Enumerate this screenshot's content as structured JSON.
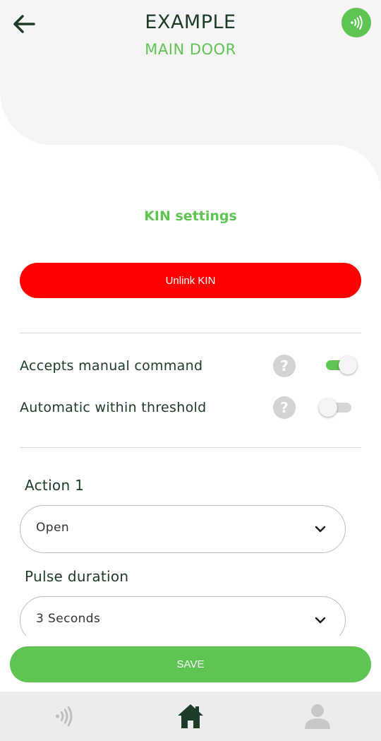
{
  "header": {
    "title": "EXAMPLE",
    "subtitle": "MAIN DOOR",
    "back_icon": "arrow-left-icon",
    "badge_icon": "nfc-icon"
  },
  "settings": {
    "section_title": "KIN settings",
    "unlink_label": "Unlink KIN",
    "options": [
      {
        "label": "Accepts manual command",
        "help": "?",
        "enabled": true
      },
      {
        "label": "Automatic within threshold",
        "help": "?",
        "enabled": false
      }
    ]
  },
  "form": {
    "action_label": "Action 1",
    "action_value": "Open",
    "pulse_label": "Pulse duration",
    "pulse_value": "3 Seconds"
  },
  "save_label": "SAVE",
  "bottom_nav": [
    {
      "icon": "nfc-icon",
      "active": false
    },
    {
      "icon": "home-icon",
      "active": true
    },
    {
      "icon": "user-icon",
      "active": false
    }
  ],
  "colors": {
    "brand_green": "#5ec452",
    "dark_green": "#1d3b27",
    "danger_red": "#ff0000",
    "header_grey": "#f5f5f5"
  }
}
